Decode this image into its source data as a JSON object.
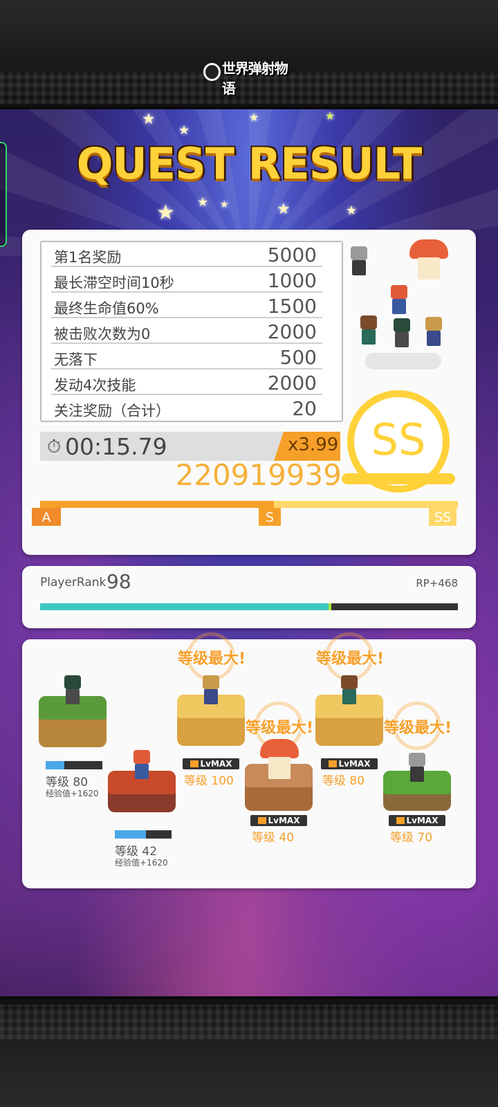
{
  "header": {
    "logo_text": "世界弹射物语"
  },
  "title": "QUEST RESULT",
  "bonuses": [
    {
      "label": "第1名奖励",
      "value": "5000"
    },
    {
      "label": "最长滞空时间10秒",
      "value": "1000"
    },
    {
      "label": "最终生命值60%",
      "value": "1500"
    },
    {
      "label": "被击败次数为0",
      "value": "2000"
    },
    {
      "label": "无落下",
      "value": "500"
    },
    {
      "label": "发动4次技能",
      "value": "2000"
    },
    {
      "label": "关注奖励（合计）",
      "value": "20"
    }
  ],
  "timer": {
    "icon": "stopwatch-icon",
    "time": "00:15.79",
    "multiplier": "x3.99"
  },
  "score": "220919939",
  "rank": {
    "grade": "SS",
    "markers": [
      "A",
      "S",
      "SS"
    ],
    "progress_fraction": 0.56
  },
  "player": {
    "rank_label": "PlayerRank",
    "rank_value": "98",
    "rp_text": "RP+468",
    "progress_fraction": 0.69
  },
  "units": [
    {
      "level_text": "等级 80",
      "exp_text": "经验值+1620",
      "maxed": false,
      "xp_fraction": 0.33,
      "color": "#5a9a3a"
    },
    {
      "level_text": "等级 42",
      "exp_text": "经验值+1620",
      "maxed": false,
      "xp_fraction": 0.55,
      "color": "#c84a2a"
    },
    {
      "level_text": "等级 100",
      "maxed": true,
      "lvmax": "LvMAX",
      "badge": "等级最大!",
      "color": "#f0c860"
    },
    {
      "level_text": "等级 40",
      "maxed": true,
      "lvmax": "LvMAX",
      "badge": "等级最大!",
      "color": "#c88a5a"
    },
    {
      "level_text": "等级 80",
      "maxed": true,
      "lvmax": "LvMAX",
      "badge": "等级最大!",
      "color": "#f0c860"
    },
    {
      "level_text": "等级 70",
      "maxed": true,
      "lvmax": "LvMAX",
      "badge": "等级最大!",
      "color": "#5aa83a"
    }
  ],
  "colors": {
    "accent_orange": "#f6a02a",
    "gold": "#ffd23a",
    "teal": "#3cc8c0"
  }
}
